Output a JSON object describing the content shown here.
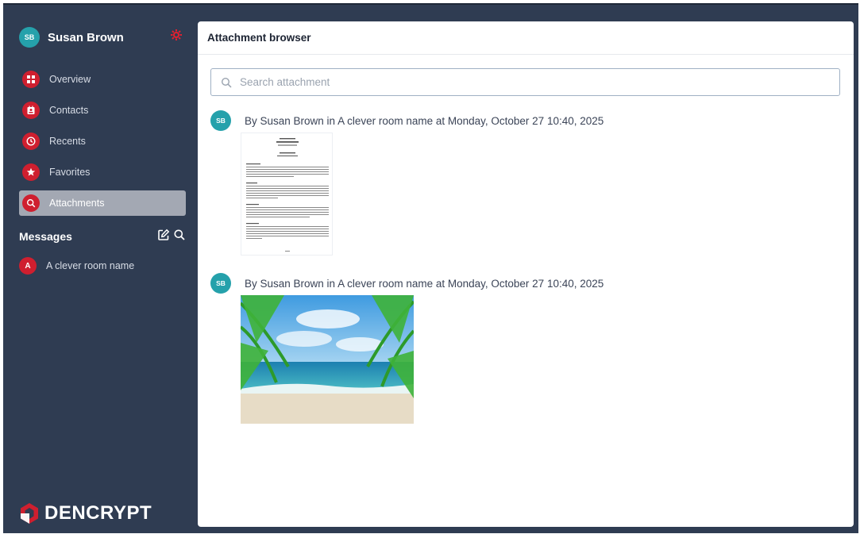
{
  "user": {
    "initials": "SB",
    "name": "Susan Brown"
  },
  "nav": [
    {
      "id": "overview",
      "label": "Overview",
      "icon": "grid-icon",
      "active": false
    },
    {
      "id": "contacts",
      "label": "Contacts",
      "icon": "contact-card-icon",
      "active": false
    },
    {
      "id": "recents",
      "label": "Recents",
      "icon": "clock-icon",
      "active": false
    },
    {
      "id": "favorites",
      "label": "Favorites",
      "icon": "star-icon",
      "active": false
    },
    {
      "id": "attachments",
      "label": "Attachments",
      "icon": "search-icon",
      "active": true
    }
  ],
  "messages": {
    "title": "Messages",
    "rooms": [
      {
        "initial": "A",
        "name": "A clever room name"
      }
    ]
  },
  "brand": {
    "name": "DENCRYPT",
    "accent": "#cf1f2f"
  },
  "main": {
    "title": "Attachment browser",
    "search_placeholder": "Search attachment",
    "entries": [
      {
        "initials": "SB",
        "text": "By Susan Brown in A clever room name at Monday, October 27 10:40, 2025",
        "kind": "document"
      },
      {
        "initials": "SB",
        "text": "By Susan Brown in A clever room name at Monday, October 27 10:40, 2025",
        "kind": "image"
      }
    ]
  },
  "colors": {
    "sidebar": "#2f3c52",
    "avatar": "#25a1ab",
    "accent": "#cf1f2f"
  }
}
